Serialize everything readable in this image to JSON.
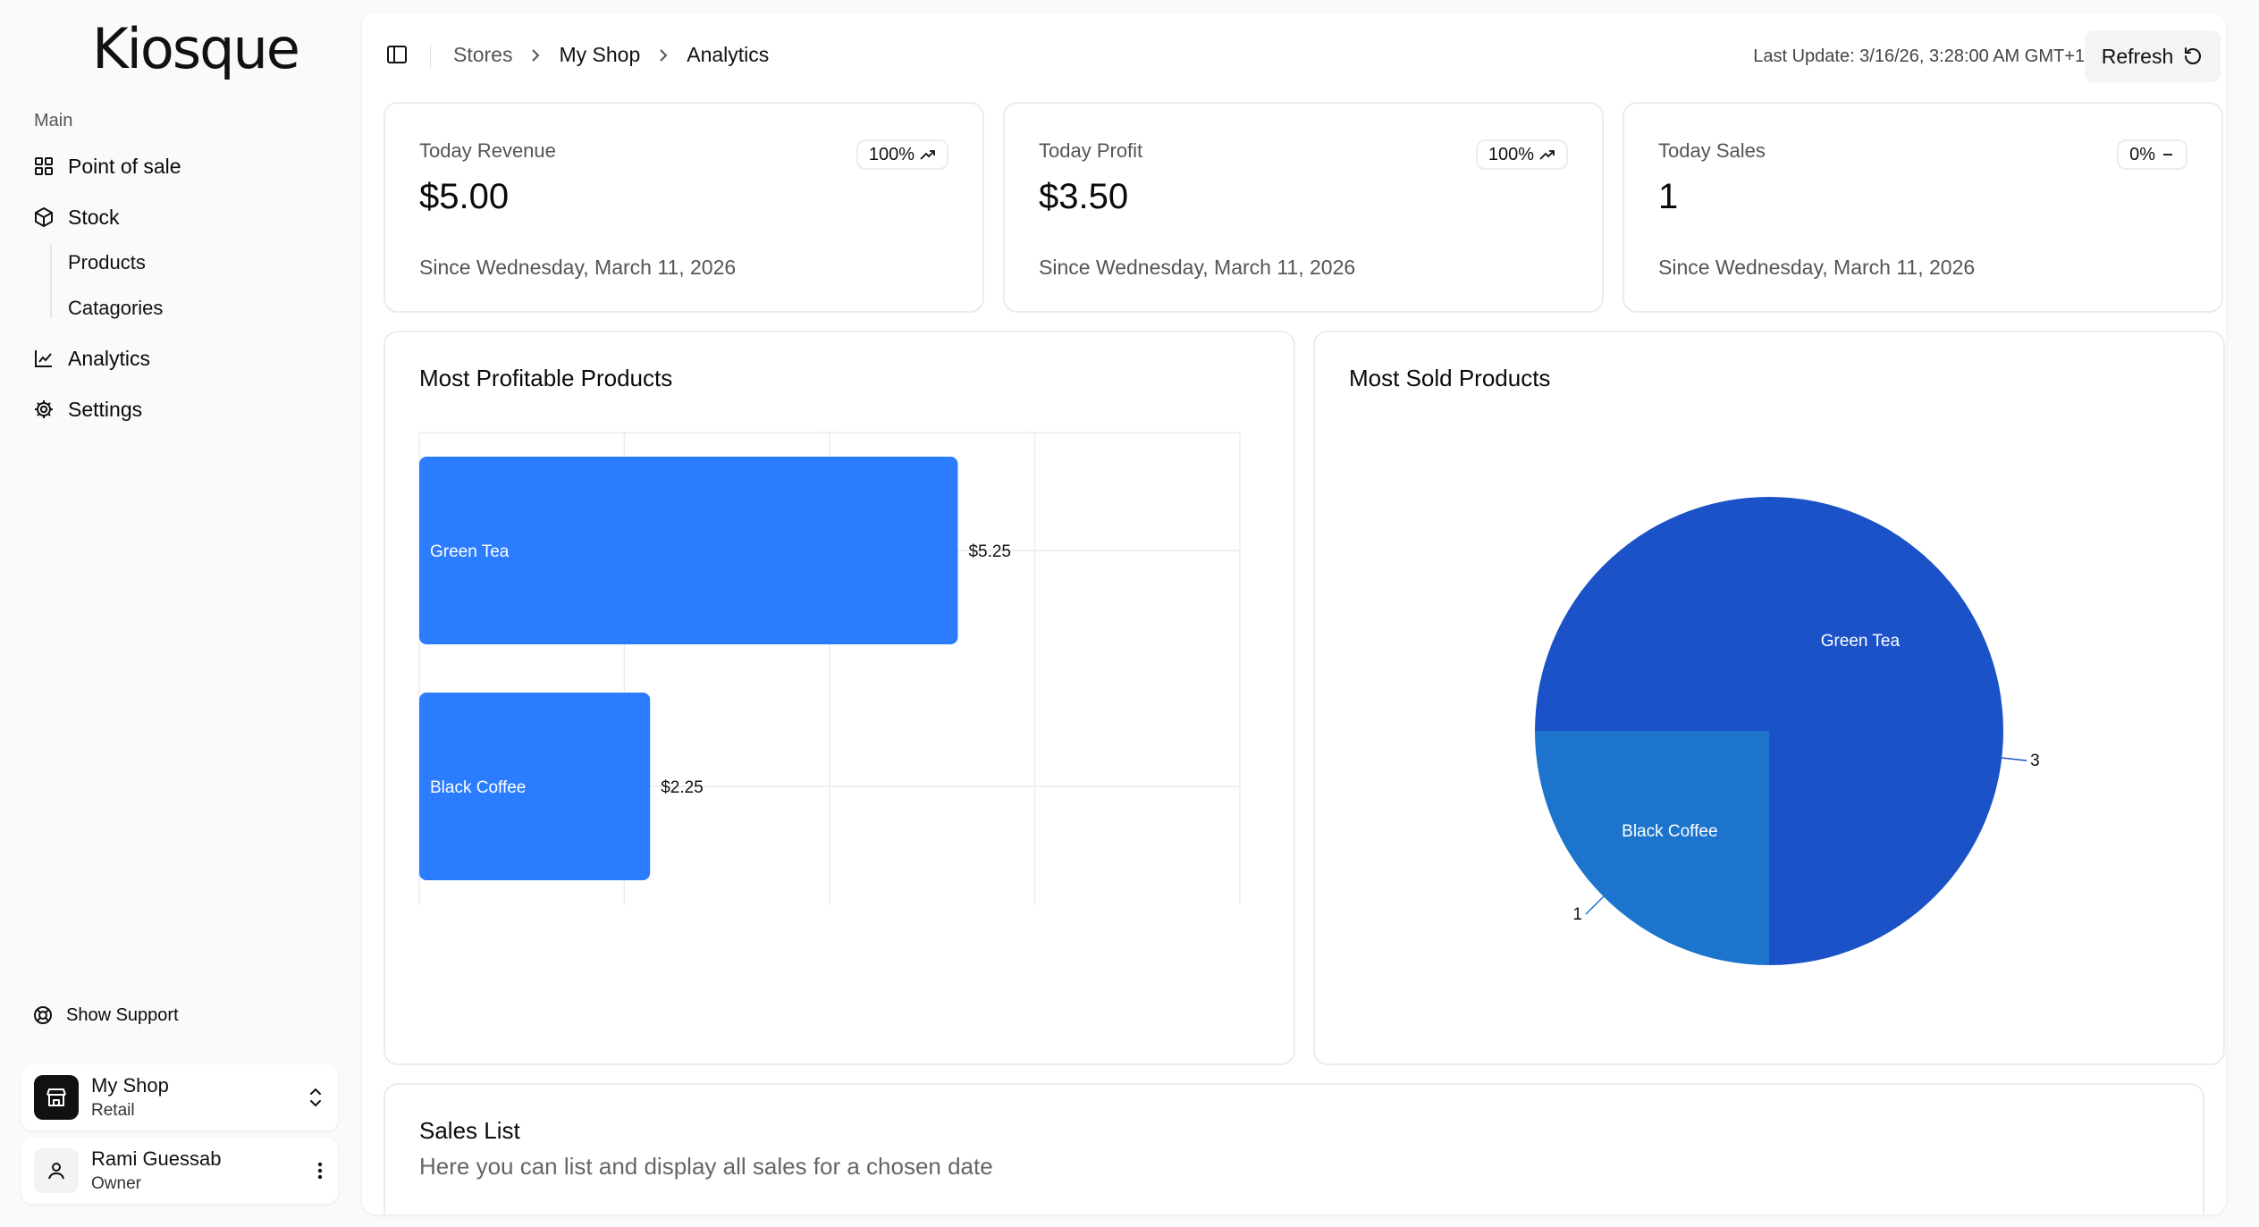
{
  "sidebar": {
    "logo": "Kiosque",
    "section_label": "Main",
    "items": [
      {
        "label": "Point of sale",
        "icon": "grid-icon"
      },
      {
        "label": "Stock",
        "icon": "box-icon"
      },
      {
        "label": "Analytics",
        "icon": "chart-icon"
      },
      {
        "label": "Settings",
        "icon": "gear-icon"
      }
    ],
    "sub_items": [
      "Products",
      "Catagories"
    ],
    "support": "Show Support",
    "shop": {
      "name": "My Shop",
      "type": "Retail"
    },
    "user": {
      "name": "Rami Guessab",
      "role": "Owner"
    }
  },
  "header": {
    "breadcrumbs": [
      "Stores",
      "My Shop",
      "Analytics"
    ],
    "last_update": "Last Update: 3/16/26, 3:28:00 AM GMT+1",
    "refresh_label": "Refresh"
  },
  "stats": [
    {
      "label": "Today Revenue",
      "value": "$5.00",
      "badge": "100%",
      "trend": "up",
      "since": "Since Wednesday, March 11, 2026"
    },
    {
      "label": "Today Profit",
      "value": "$3.50",
      "badge": "100%",
      "trend": "up",
      "since": "Since Wednesday, March 11, 2026"
    },
    {
      "label": "Today Sales",
      "value": "1",
      "badge": "0%",
      "trend": "flat",
      "since": "Since Wednesday, March 11, 2026"
    }
  ],
  "chart_data": [
    {
      "type": "bar",
      "orientation": "horizontal",
      "title": "Most Profitable Products",
      "categories": [
        "Green Tea",
        "Black Coffee"
      ],
      "values": [
        5.25,
        2.25
      ],
      "value_labels": [
        "$5.25",
        "$2.25"
      ],
      "xlim": [
        0,
        8
      ],
      "grid": true,
      "color": "#2b7cff"
    },
    {
      "type": "pie",
      "title": "Most Sold Products",
      "labels": [
        "Green Tea",
        "Black Coffee"
      ],
      "values": [
        3,
        1
      ],
      "value_labels": [
        "3",
        "1"
      ],
      "colors": [
        "#1c52c8",
        "#1c74cc"
      ]
    }
  ],
  "sales_list": {
    "title": "Sales List",
    "subtitle": "Here you can list and display all sales for a chosen date"
  }
}
